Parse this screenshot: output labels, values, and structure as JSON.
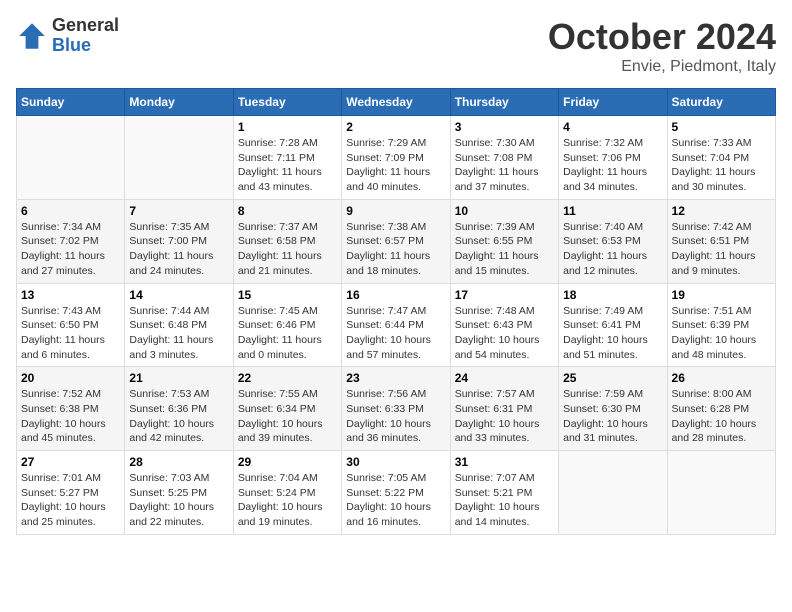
{
  "header": {
    "logo_general": "General",
    "logo_blue": "Blue",
    "month_title": "October 2024",
    "location": "Envie, Piedmont, Italy"
  },
  "calendar": {
    "days_of_week": [
      "Sunday",
      "Monday",
      "Tuesday",
      "Wednesday",
      "Thursday",
      "Friday",
      "Saturday"
    ],
    "weeks": [
      [
        {
          "day": "",
          "info": ""
        },
        {
          "day": "",
          "info": ""
        },
        {
          "day": "1",
          "info": "Sunrise: 7:28 AM\nSunset: 7:11 PM\nDaylight: 11 hours and 43 minutes."
        },
        {
          "day": "2",
          "info": "Sunrise: 7:29 AM\nSunset: 7:09 PM\nDaylight: 11 hours and 40 minutes."
        },
        {
          "day": "3",
          "info": "Sunrise: 7:30 AM\nSunset: 7:08 PM\nDaylight: 11 hours and 37 minutes."
        },
        {
          "day": "4",
          "info": "Sunrise: 7:32 AM\nSunset: 7:06 PM\nDaylight: 11 hours and 34 minutes."
        },
        {
          "day": "5",
          "info": "Sunrise: 7:33 AM\nSunset: 7:04 PM\nDaylight: 11 hours and 30 minutes."
        }
      ],
      [
        {
          "day": "6",
          "info": "Sunrise: 7:34 AM\nSunset: 7:02 PM\nDaylight: 11 hours and 27 minutes."
        },
        {
          "day": "7",
          "info": "Sunrise: 7:35 AM\nSunset: 7:00 PM\nDaylight: 11 hours and 24 minutes."
        },
        {
          "day": "8",
          "info": "Sunrise: 7:37 AM\nSunset: 6:58 PM\nDaylight: 11 hours and 21 minutes."
        },
        {
          "day": "9",
          "info": "Sunrise: 7:38 AM\nSunset: 6:57 PM\nDaylight: 11 hours and 18 minutes."
        },
        {
          "day": "10",
          "info": "Sunrise: 7:39 AM\nSunset: 6:55 PM\nDaylight: 11 hours and 15 minutes."
        },
        {
          "day": "11",
          "info": "Sunrise: 7:40 AM\nSunset: 6:53 PM\nDaylight: 11 hours and 12 minutes."
        },
        {
          "day": "12",
          "info": "Sunrise: 7:42 AM\nSunset: 6:51 PM\nDaylight: 11 hours and 9 minutes."
        }
      ],
      [
        {
          "day": "13",
          "info": "Sunrise: 7:43 AM\nSunset: 6:50 PM\nDaylight: 11 hours and 6 minutes."
        },
        {
          "day": "14",
          "info": "Sunrise: 7:44 AM\nSunset: 6:48 PM\nDaylight: 11 hours and 3 minutes."
        },
        {
          "day": "15",
          "info": "Sunrise: 7:45 AM\nSunset: 6:46 PM\nDaylight: 11 hours and 0 minutes."
        },
        {
          "day": "16",
          "info": "Sunrise: 7:47 AM\nSunset: 6:44 PM\nDaylight: 10 hours and 57 minutes."
        },
        {
          "day": "17",
          "info": "Sunrise: 7:48 AM\nSunset: 6:43 PM\nDaylight: 10 hours and 54 minutes."
        },
        {
          "day": "18",
          "info": "Sunrise: 7:49 AM\nSunset: 6:41 PM\nDaylight: 10 hours and 51 minutes."
        },
        {
          "day": "19",
          "info": "Sunrise: 7:51 AM\nSunset: 6:39 PM\nDaylight: 10 hours and 48 minutes."
        }
      ],
      [
        {
          "day": "20",
          "info": "Sunrise: 7:52 AM\nSunset: 6:38 PM\nDaylight: 10 hours and 45 minutes."
        },
        {
          "day": "21",
          "info": "Sunrise: 7:53 AM\nSunset: 6:36 PM\nDaylight: 10 hours and 42 minutes."
        },
        {
          "day": "22",
          "info": "Sunrise: 7:55 AM\nSunset: 6:34 PM\nDaylight: 10 hours and 39 minutes."
        },
        {
          "day": "23",
          "info": "Sunrise: 7:56 AM\nSunset: 6:33 PM\nDaylight: 10 hours and 36 minutes."
        },
        {
          "day": "24",
          "info": "Sunrise: 7:57 AM\nSunset: 6:31 PM\nDaylight: 10 hours and 33 minutes."
        },
        {
          "day": "25",
          "info": "Sunrise: 7:59 AM\nSunset: 6:30 PM\nDaylight: 10 hours and 31 minutes."
        },
        {
          "day": "26",
          "info": "Sunrise: 8:00 AM\nSunset: 6:28 PM\nDaylight: 10 hours and 28 minutes."
        }
      ],
      [
        {
          "day": "27",
          "info": "Sunrise: 7:01 AM\nSunset: 5:27 PM\nDaylight: 10 hours and 25 minutes."
        },
        {
          "day": "28",
          "info": "Sunrise: 7:03 AM\nSunset: 5:25 PM\nDaylight: 10 hours and 22 minutes."
        },
        {
          "day": "29",
          "info": "Sunrise: 7:04 AM\nSunset: 5:24 PM\nDaylight: 10 hours and 19 minutes."
        },
        {
          "day": "30",
          "info": "Sunrise: 7:05 AM\nSunset: 5:22 PM\nDaylight: 10 hours and 16 minutes."
        },
        {
          "day": "31",
          "info": "Sunrise: 7:07 AM\nSunset: 5:21 PM\nDaylight: 10 hours and 14 minutes."
        },
        {
          "day": "",
          "info": ""
        },
        {
          "day": "",
          "info": ""
        }
      ]
    ]
  }
}
